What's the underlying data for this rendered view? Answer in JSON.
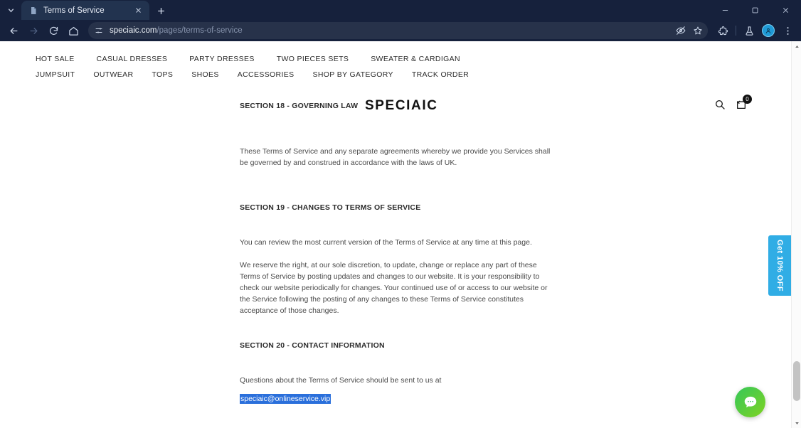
{
  "browser": {
    "tab": {
      "title": "Terms of Service",
      "favicon_icon": "document-icon",
      "close_icon": "close-icon"
    },
    "tab_list_icon": "chevron-down-icon",
    "new_tab_icon": "plus-icon",
    "window_controls": {
      "minimize_icon": "minimize-icon",
      "maximize_icon": "maximize-icon",
      "close_icon": "window-close-icon"
    },
    "nav": {
      "back_icon": "arrow-back-icon",
      "forward_icon": "arrow-forward-icon",
      "reload_icon": "reload-icon",
      "home_icon": "home-icon"
    },
    "omnibox": {
      "site_settings_icon": "tune-icon",
      "url_domain": "speciaic.com",
      "url_path": "/pages/terms-of-service",
      "tracking_icon": "eye-off-icon",
      "bookmark_icon": "star-icon"
    },
    "toolbar": {
      "extensions_icon": "puzzle-icon",
      "labs_icon": "flask-icon",
      "profile_icon": "account-avatar-icon",
      "menu_icon": "three-dot-menu-icon"
    },
    "accent_color": "#16213c",
    "tab_color": "#22334f"
  },
  "site": {
    "logo": "SPECIAIC",
    "nav_row_1": [
      {
        "label": "HOT SALE"
      },
      {
        "label": "CASUAL DRESSES"
      },
      {
        "label": "PARTY DRESSES"
      },
      {
        "label": "TWO PIECES SETS"
      },
      {
        "label": "SWEATER & CARDIGAN"
      }
    ],
    "nav_row_2": [
      {
        "label": "JUMPSUIT"
      },
      {
        "label": "OUTWEAR"
      },
      {
        "label": "TOPS"
      },
      {
        "label": "SHOES"
      },
      {
        "label": "ACCESSORIES"
      },
      {
        "label": "SHOP BY GATEGORY"
      },
      {
        "label": "TRACK ORDER"
      }
    ],
    "header_icons": {
      "search_icon": "search-icon",
      "cart_icon": "cart-icon",
      "cart_count": "0"
    }
  },
  "content": {
    "section_18": {
      "heading": "SECTION 18 - GOVERNING LAW",
      "body": "These Terms of Service and any separate agreements whereby we provide you Services shall be governed by and construed in accordance with the laws of UK."
    },
    "section_19": {
      "heading": "SECTION 19 - CHANGES TO TERMS OF SERVICE",
      "body_1": "You can review the most current version of the Terms of Service at any time at this page.",
      "body_2": "We reserve the right, at our sole discretion, to update, change or replace any part of these Terms of Service by posting updates and changes to our website. It is your responsibility to check our website periodically for changes. Your continued use of or access to our website or the Service following the posting of any changes to these Terms of Service constitutes acceptance of those changes."
    },
    "section_20": {
      "heading": "SECTION 20 - CONTACT INFORMATION",
      "body": "Questions about the Terms of Service should be sent to us at",
      "email": "speciaic@onlineservice.vip",
      "email_selected": true,
      "selection_color": "#2a6fdb"
    }
  },
  "widgets": {
    "promo_tab": {
      "label": "Get 10% OFF",
      "color": "#30ade5"
    },
    "chat_button": {
      "icon": "chat-bubble-icon",
      "color": "#35c75a"
    }
  },
  "scrollbar": {
    "up_arrow_icon": "chevron-up-icon",
    "down_arrow_icon": "chevron-down-icon"
  }
}
